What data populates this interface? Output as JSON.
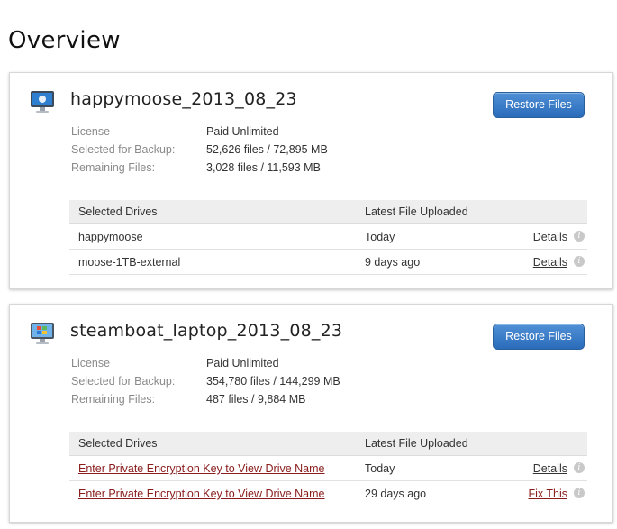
{
  "page": {
    "title": "Overview"
  },
  "computers": [
    {
      "name": "happymoose_2013_08_23",
      "os_icon": "mac-monitor-icon",
      "restore_label": "Restore Files",
      "info": [
        {
          "label": "License",
          "value": "Paid Unlimited"
        },
        {
          "label": "Selected for Backup:",
          "value": "52,626 files / 72,895 MB"
        },
        {
          "label": "Remaining Files:",
          "value": "3,028 files / 11,593 MB"
        }
      ],
      "drives_header": {
        "drive": "Selected Drives",
        "latest": "Latest File Uploaded"
      },
      "drives": [
        {
          "name": "happymoose",
          "latest": "Today",
          "action": "Details"
        },
        {
          "name": "moose-1TB-external",
          "latest": "9 days ago",
          "action": "Details"
        }
      ]
    },
    {
      "name": "steamboat_laptop_2013_08_23",
      "os_icon": "windows-monitor-icon",
      "restore_label": "Restore Files",
      "info": [
        {
          "label": "License",
          "value": "Paid Unlimited"
        },
        {
          "label": "Selected for Backup:",
          "value": "354,780 files / 144,299 MB"
        },
        {
          "label": "Remaining Files:",
          "value": "487 files / 9,884 MB"
        }
      ],
      "drives_header": {
        "drive": "Selected Drives",
        "latest": "Latest File Uploaded"
      },
      "drives": [
        {
          "name": "Enter Private Encryption Key to View Drive Name",
          "latest": "Today",
          "action": "Details"
        },
        {
          "name": "Enter Private Encryption Key to View Drive Name",
          "latest": "29 days ago",
          "action": "Fix This"
        }
      ]
    }
  ],
  "info_icon_glyph": "i"
}
